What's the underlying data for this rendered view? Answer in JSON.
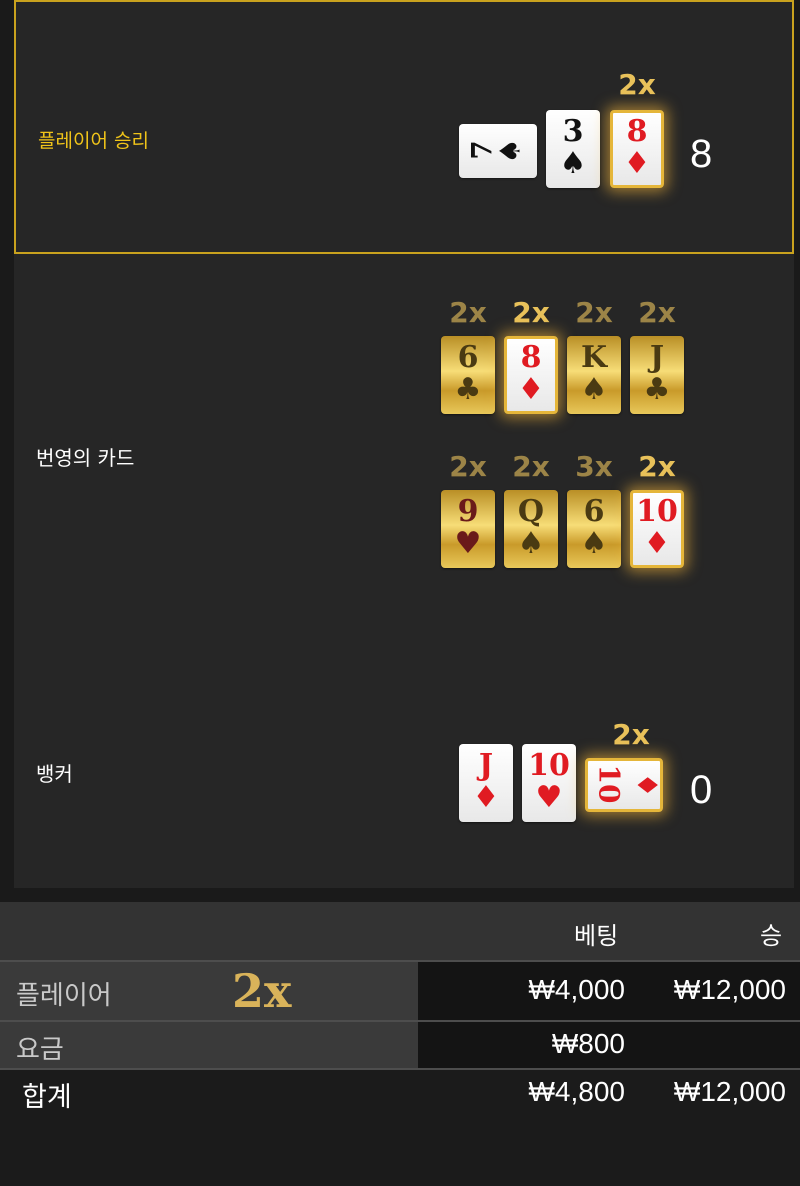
{
  "rows": {
    "player": {
      "label": "플레이어 승리",
      "score": "8",
      "multiplier": "2x",
      "cards": [
        {
          "rank": "7",
          "suit": "♠",
          "color": "black",
          "orientation": "sideways"
        },
        {
          "rank": "3",
          "suit": "♠",
          "color": "black"
        },
        {
          "rank": "8",
          "suit": "♦",
          "color": "red",
          "highlight": true
        }
      ]
    },
    "lucky": {
      "label": "번영의 카드",
      "row1": [
        {
          "rank": "6",
          "suit": "♣",
          "color": "black",
          "mult": "2x"
        },
        {
          "rank": "8",
          "suit": "♦",
          "color": "red",
          "mult": "2x",
          "highlight": true
        },
        {
          "rank": "K",
          "suit": "♠",
          "color": "black",
          "mult": "2x"
        },
        {
          "rank": "J",
          "suit": "♣",
          "color": "black",
          "mult": "2x"
        }
      ],
      "row2": [
        {
          "rank": "9",
          "suit": "♥",
          "color": "red",
          "mult": "2x"
        },
        {
          "rank": "Q",
          "suit": "♠",
          "color": "black",
          "mult": "2x"
        },
        {
          "rank": "6",
          "suit": "♠",
          "color": "black",
          "mult": "3x"
        },
        {
          "rank": "10",
          "suit": "♦",
          "color": "red",
          "mult": "2x",
          "highlight": true
        }
      ]
    },
    "banker": {
      "label": "뱅커",
      "score": "0",
      "multiplier": "2x",
      "cards": [
        {
          "rank": "J",
          "suit": "♦",
          "color": "red"
        },
        {
          "rank": "10",
          "suit": "♥",
          "color": "red"
        },
        {
          "rank": "10",
          "suit": "♦",
          "color": "red",
          "highlight": true,
          "orientation": "sideways"
        }
      ]
    }
  },
  "table": {
    "col_bet": "베팅",
    "col_win": "승",
    "player_row": {
      "name": "플레이어",
      "multiplier": "2x",
      "bet": "₩4,000",
      "win": "₩12,000"
    },
    "fee_row": {
      "name": "요금",
      "bet": "₩800"
    },
    "total_row": {
      "name": "합계",
      "bet": "₩4,800",
      "win": "₩12,000"
    }
  },
  "colors": {
    "gold_accent": "#e8c15a",
    "label_yellow": "#f0c419",
    "card_red": "#e01b22"
  }
}
